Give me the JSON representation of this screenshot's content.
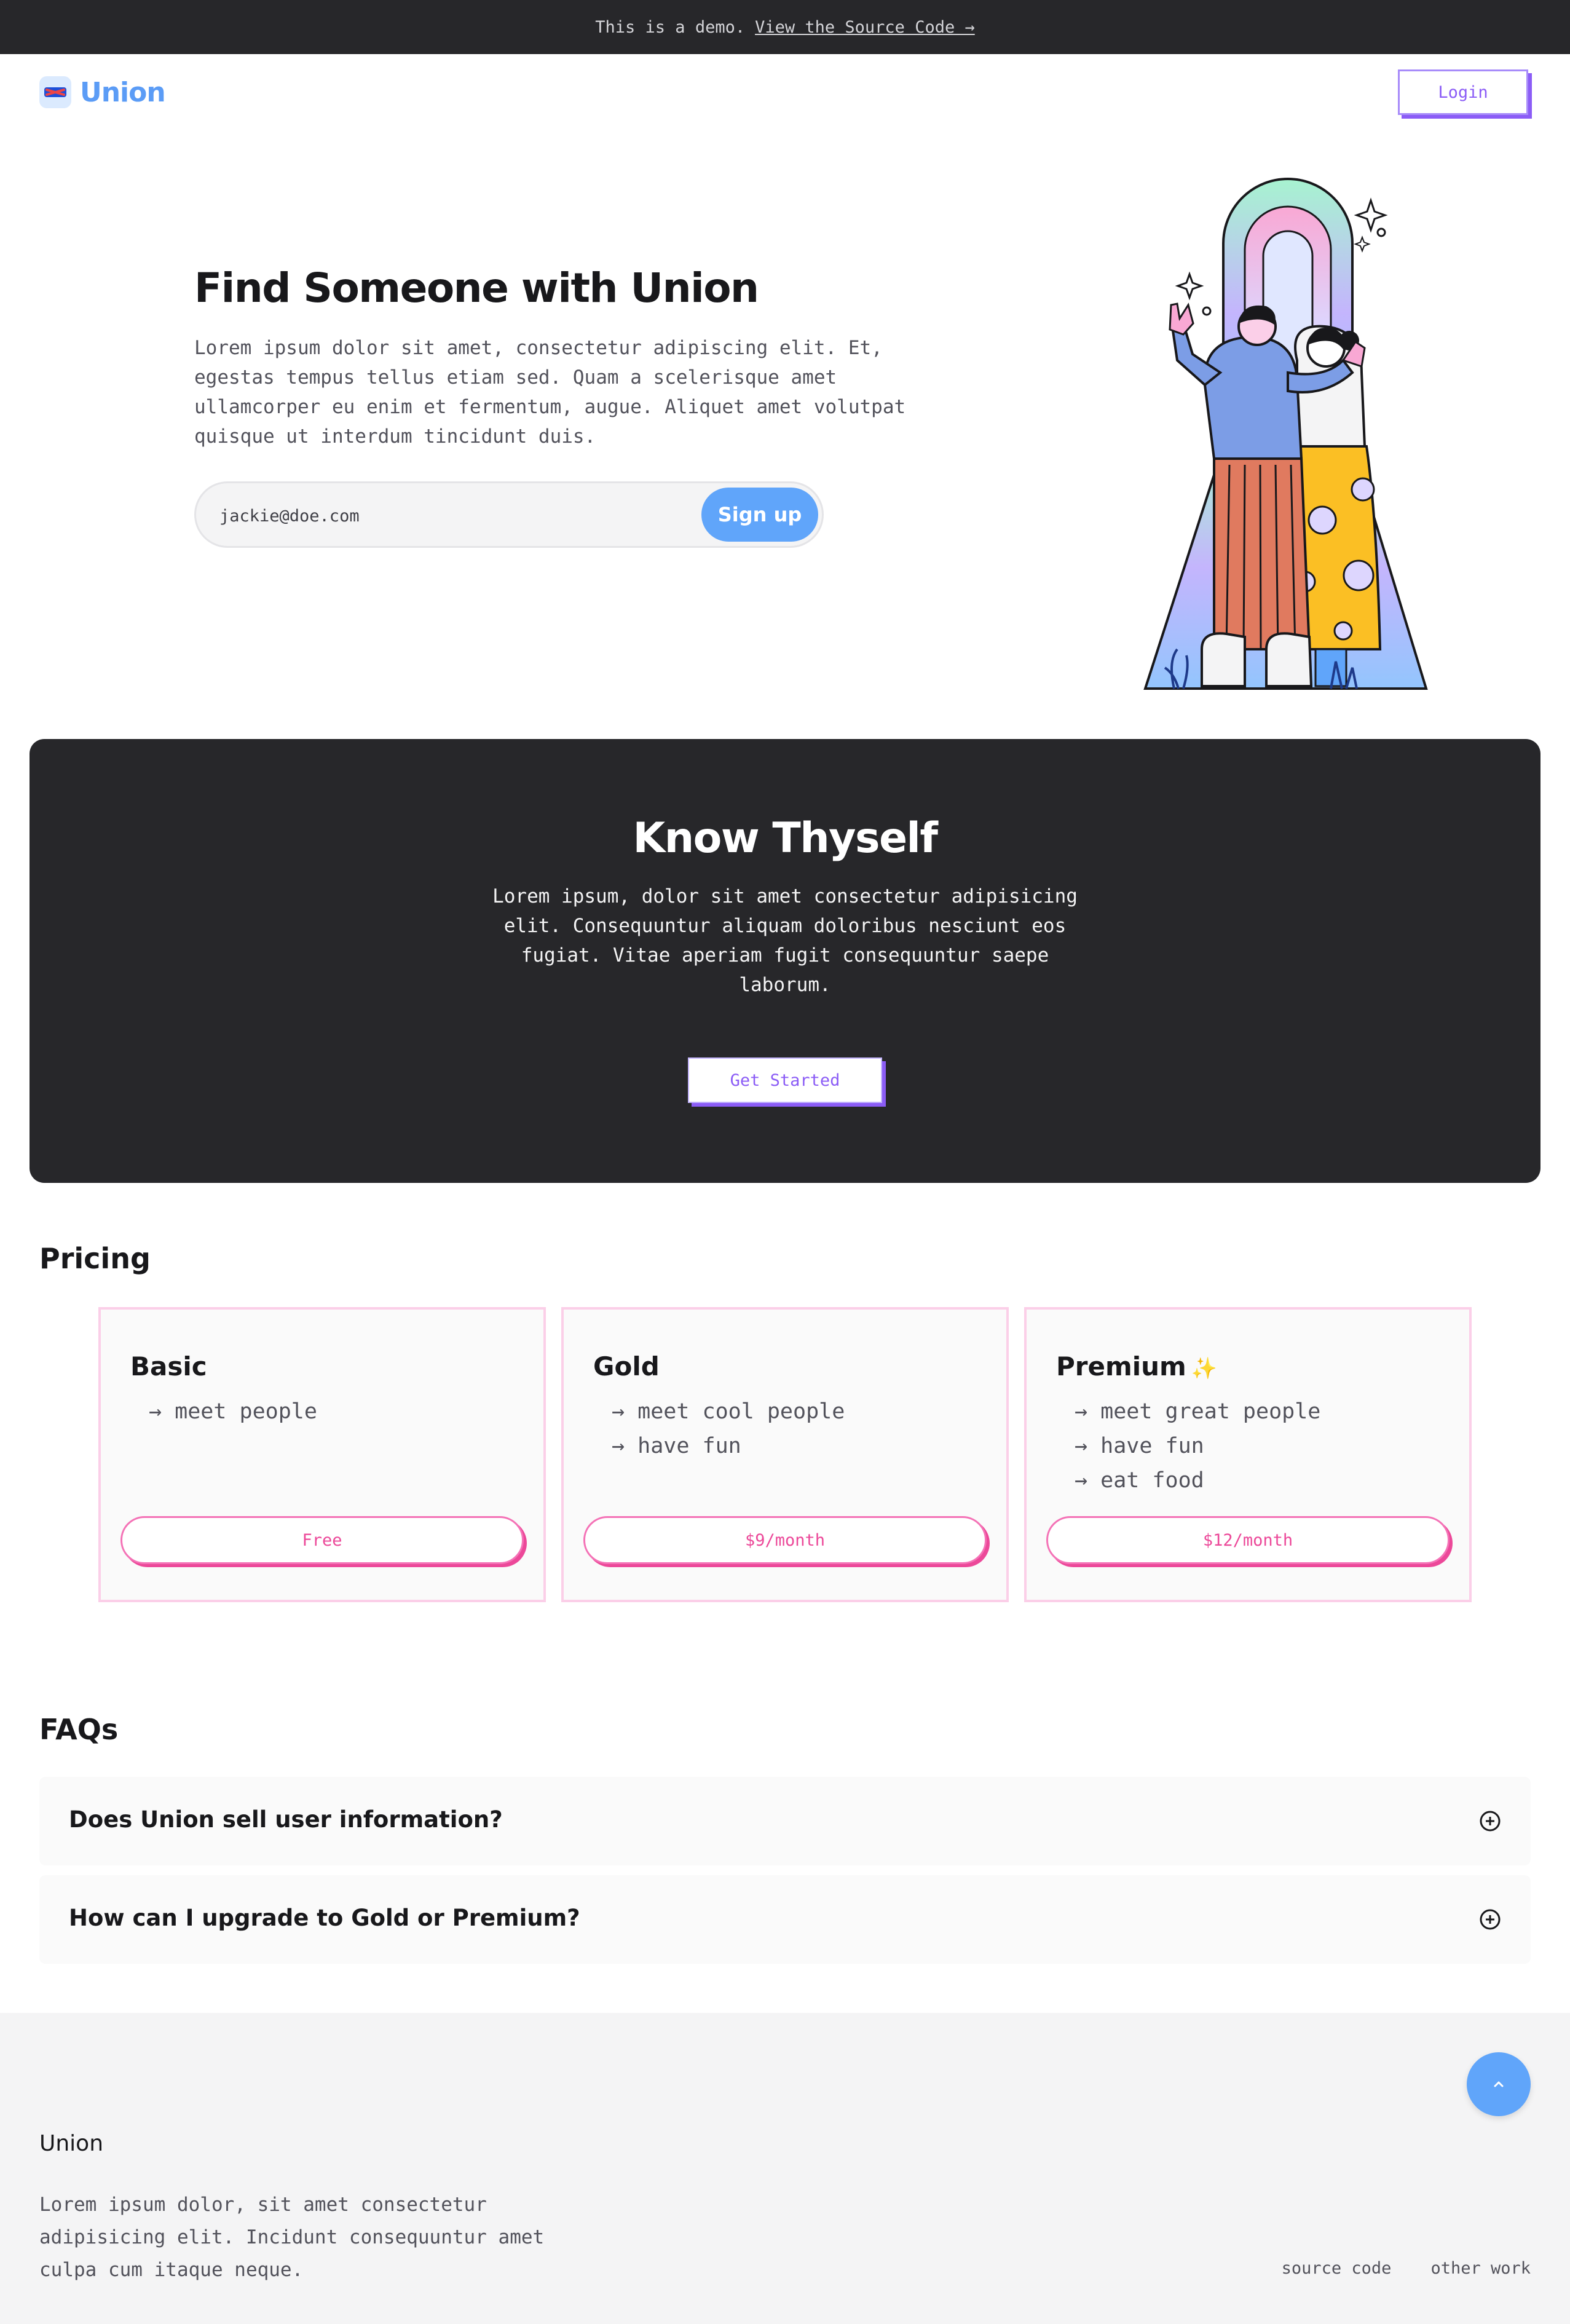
{
  "banner": {
    "text": "This is a demo.",
    "link": "View the Source Code →"
  },
  "header": {
    "brand": "Union",
    "login_label": "Login"
  },
  "hero": {
    "title": "Find Someone with Union",
    "description": "Lorem ipsum dolor sit amet, consectetur adipiscing elit. Et, egestas tempus tellus etiam sed. Quam a scelerisque amet ullamcorper eu enim et fermentum, augue. Aliquet amet volutpat quisque ut interdum tincidunt duis.",
    "email_value": "jackie@doe.com",
    "signup_label": "Sign up"
  },
  "about": {
    "title": "Know Thyself",
    "description": "Lorem ipsum, dolor sit amet consectetur adipisicing elit. Consequuntur aliquam doloribus nesciunt eos fugiat. Vitae aperiam fugit consequuntur saepe laborum.",
    "cta_label": "Get Started"
  },
  "pricing": {
    "title": "Pricing",
    "plans": [
      {
        "name": "Basic",
        "features": [
          "→ meet people"
        ],
        "price": "Free"
      },
      {
        "name": "Gold",
        "features": [
          "→ meet cool people",
          "→ have fun"
        ],
        "price": "$9/month"
      },
      {
        "name": "Premium",
        "sparkle": "✨",
        "features": [
          "→ meet great people",
          "→ have fun",
          "→ eat food"
        ],
        "price": "$12/month"
      }
    ]
  },
  "faqs": {
    "title": "FAQs",
    "items": [
      {
        "question": "Does Union sell user information?"
      },
      {
        "question": "How can I upgrade to Gold or Premium?"
      }
    ]
  },
  "footer": {
    "brand": "Union",
    "description": "Lorem ipsum dolor, sit amet consectetur adipisicing elit. Incidunt consequuntur amet culpa cum itaque neque.",
    "links": [
      "source code",
      "other work"
    ]
  },
  "colors": {
    "brand_blue": "#60a5fa",
    "accent_purple": "#8b5cf6",
    "accent_pink": "#ec4899",
    "dark_bg": "#27272a"
  }
}
